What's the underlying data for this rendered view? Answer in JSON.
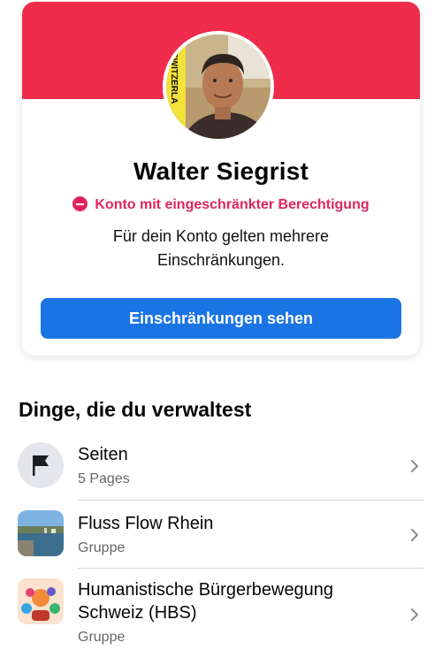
{
  "profile": {
    "name": "Walter Siegrist",
    "status": "Konto mit eingeschränkter Berechtigung",
    "description": "Für dein Konto gelten mehrere Einschränkungen.",
    "button_label": "Einschränkungen sehen",
    "avatar_sign_text": "SWITZERLA"
  },
  "colors": {
    "banner": "#ef2c4b",
    "restricted": "#e0245e",
    "button": "#1b74e4"
  },
  "manage": {
    "title": "Dinge, die du verwaltest",
    "items": [
      {
        "title": "Seiten",
        "subtitle": "5 Pages",
        "icon": "flag-icon"
      },
      {
        "title": "Fluss Flow Rhein",
        "subtitle": "Gruppe",
        "icon": "river-group-thumbnail"
      },
      {
        "title": "Humanistische Bürgerbewegung Schweiz (HBS)",
        "subtitle": "Gruppe",
        "icon": "hbs-group-thumbnail"
      }
    ]
  }
}
